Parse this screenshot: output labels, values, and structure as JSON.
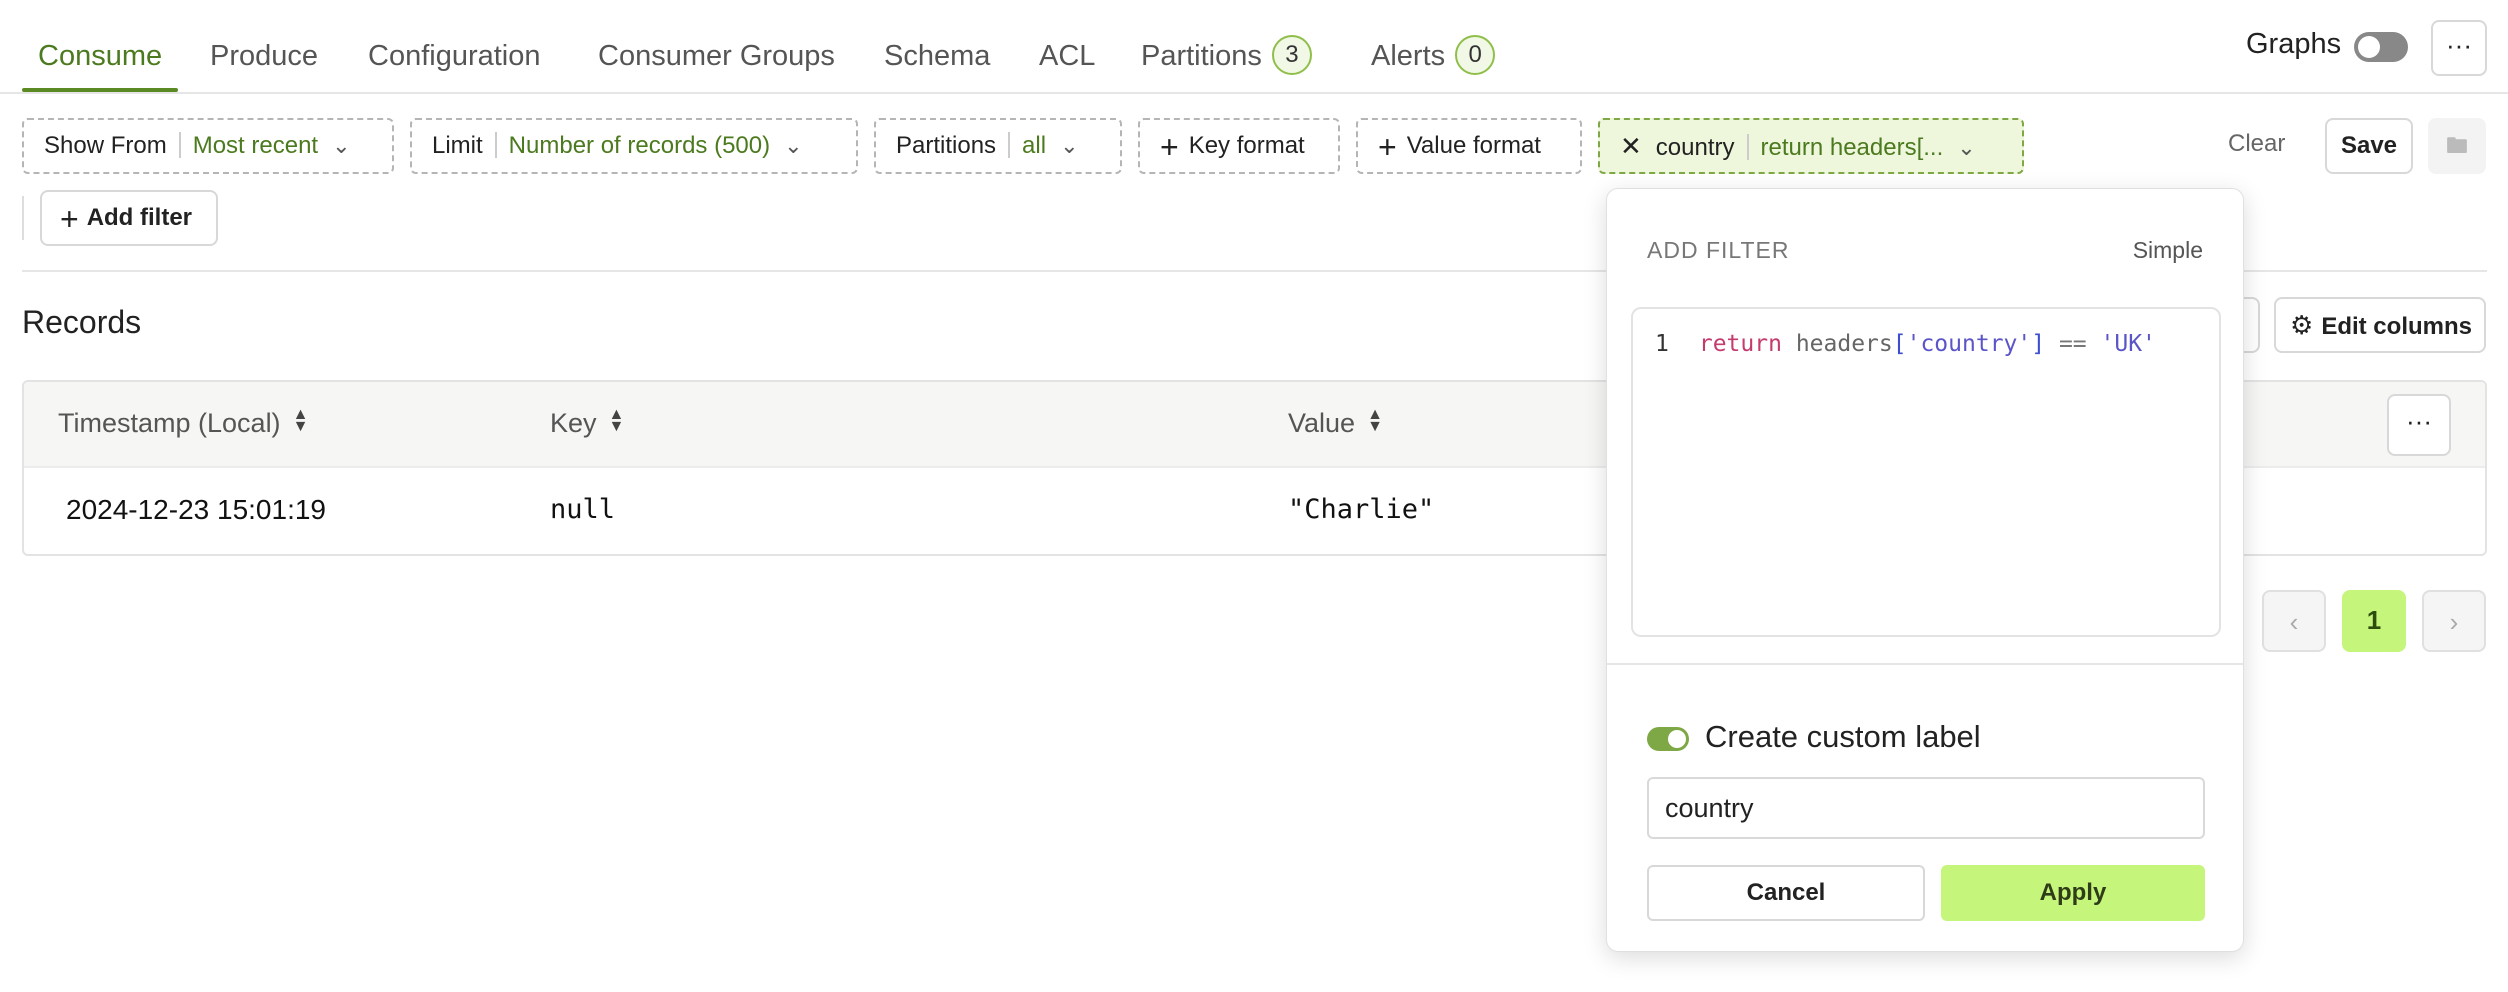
{
  "tabs": [
    {
      "label": "Consume",
      "active": true
    },
    {
      "label": "Produce"
    },
    {
      "label": "Configuration"
    },
    {
      "label": "Consumer Groups"
    },
    {
      "label": "Schema"
    },
    {
      "label": "ACL"
    },
    {
      "label": "Partitions",
      "badge": "3"
    },
    {
      "label": "Alerts",
      "badge": "0"
    }
  ],
  "header": {
    "graphs_label": "Graphs",
    "graphs_enabled": false,
    "more_icon": "···"
  },
  "filters": {
    "show_from": {
      "label": "Show From",
      "value": "Most recent"
    },
    "limit": {
      "label": "Limit",
      "value": "Number of records (500)"
    },
    "partitions": {
      "label": "Partitions",
      "value": "all"
    },
    "key_format": {
      "label": "Key format"
    },
    "value_format": {
      "label": "Value format"
    },
    "active_filter": {
      "label": "country",
      "value": "return headers[..."
    },
    "clear_label": "Clear",
    "save_label": "Save",
    "add_filter_label": "Add filter"
  },
  "records": {
    "title": "Records",
    "edit_columns_label": "Edit columns",
    "columns": [
      "Timestamp (Local)",
      "Key",
      "Value"
    ],
    "rows": [
      {
        "timestamp": "2024-12-23 15:01:19",
        "key": "null",
        "value": "\"Charlie\""
      }
    ]
  },
  "pagination": {
    "current_page": "1"
  },
  "add_filter_popover": {
    "title": "ADD FILTER",
    "mode_label": "Simple",
    "code": {
      "line_number": "1",
      "keyword": "return",
      "identifier": "headers",
      "open": "[",
      "key": "'country'",
      "close": "]",
      "operator": "==",
      "value": "'UK'"
    },
    "custom_label_enabled": true,
    "custom_label_text": "Create custom label",
    "custom_label_value": "country",
    "cancel_label": "Cancel",
    "apply_label": "Apply"
  }
}
